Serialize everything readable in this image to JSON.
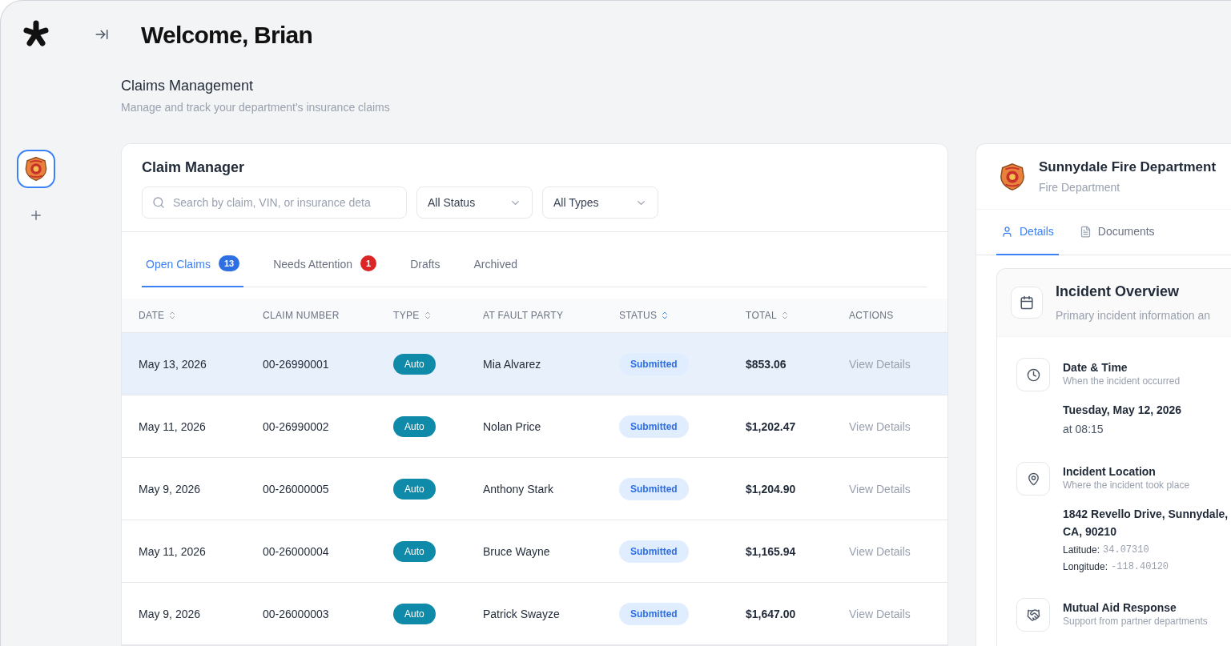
{
  "sidebar": {
    "workspaces": [
      {
        "selected": true
      }
    ]
  },
  "header": {
    "title": "Welcome, Brian"
  },
  "page": {
    "title": "Claims Management",
    "subtitle": "Manage and track your department's insurance claims"
  },
  "claim_manager": {
    "title": "Claim Manager",
    "search": {
      "placeholder": "Search by claim, VIN, or insurance deta"
    },
    "filters": [
      "All Status",
      "All Types"
    ],
    "tabs": [
      {
        "label": "Open Claims",
        "count": "13",
        "color": "#2f6fe4",
        "selected": true
      },
      {
        "label": "Needs Attention",
        "count": "1",
        "color": "#dc2626",
        "selected": false
      },
      {
        "label": "Drafts",
        "selected": false
      },
      {
        "label": "Archived",
        "selected": false
      }
    ],
    "table": {
      "columns": [
        {
          "label": "DATE",
          "sortable": true,
          "sorted": false
        },
        {
          "label": "CLAIM NUMBER",
          "sortable": false
        },
        {
          "label": "TYPE",
          "sortable": true,
          "sorted": false
        },
        {
          "label": "AT FAULT PARTY",
          "sortable": false
        },
        {
          "label": "STATUS",
          "sortable": true,
          "sorted": true
        },
        {
          "label": "TOTAL",
          "sortable": true,
          "sorted": false
        },
        {
          "label": "ACTIONS",
          "sortable": false
        }
      ],
      "rows": [
        {
          "date": "May 13, 2026",
          "claim_number": "00-26990001",
          "type": "Auto",
          "at_fault_party": "Mia Alvarez",
          "status": "Submitted",
          "total": "$853.06",
          "action": "View Details",
          "selected": true
        },
        {
          "date": "May 11, 2026",
          "claim_number": "00-26990002",
          "type": "Auto",
          "at_fault_party": "Nolan Price",
          "status": "Submitted",
          "total": "$1,202.47",
          "action": "View Details",
          "selected": false
        },
        {
          "date": "May 9, 2026",
          "claim_number": "00-26000005",
          "type": "Auto",
          "at_fault_party": "Anthony Stark",
          "status": "Submitted",
          "total": "$1,204.90",
          "action": "View Details",
          "selected": false
        },
        {
          "date": "May 11, 2026",
          "claim_number": "00-26000004",
          "type": "Auto",
          "at_fault_party": "Bruce Wayne",
          "status": "Submitted",
          "total": "$1,165.94",
          "action": "View Details",
          "selected": false
        },
        {
          "date": "May 9, 2026",
          "claim_number": "00-26000003",
          "type": "Auto",
          "at_fault_party": "Patrick Swayze",
          "status": "Submitted",
          "total": "$1,647.00",
          "action": "View Details",
          "selected": false
        }
      ]
    }
  },
  "department_panel": {
    "name": "Sunnydale Fire Department",
    "subtitle": "Fire Department",
    "tabs": [
      {
        "label": "Details",
        "kind": "person",
        "selected": true
      },
      {
        "label": "Documents",
        "kind": "document",
        "selected": false
      }
    ],
    "overview": {
      "title": "Incident Overview",
      "subtitle": "Primary incident information an",
      "sections": [
        {
          "kind": "time",
          "title": "Date & Time",
          "subtitle": "When the incident occurred",
          "value": "Tuesday, May 12, 2026",
          "note": "at 08:15"
        },
        {
          "kind": "location",
          "title": "Incident Location",
          "subtitle": "Where the incident took place",
          "value": "1842 Revello Drive, Sunnydale, CA, 90210",
          "coordinates": [
            {
              "label": "Latitude:",
              "value": "34.07310"
            },
            {
              "label": "Longitude:",
              "value": "-118.40120"
            }
          ]
        },
        {
          "kind": "aid",
          "title": "Mutual Aid Response",
          "subtitle": "Support from partner departments"
        }
      ]
    }
  }
}
